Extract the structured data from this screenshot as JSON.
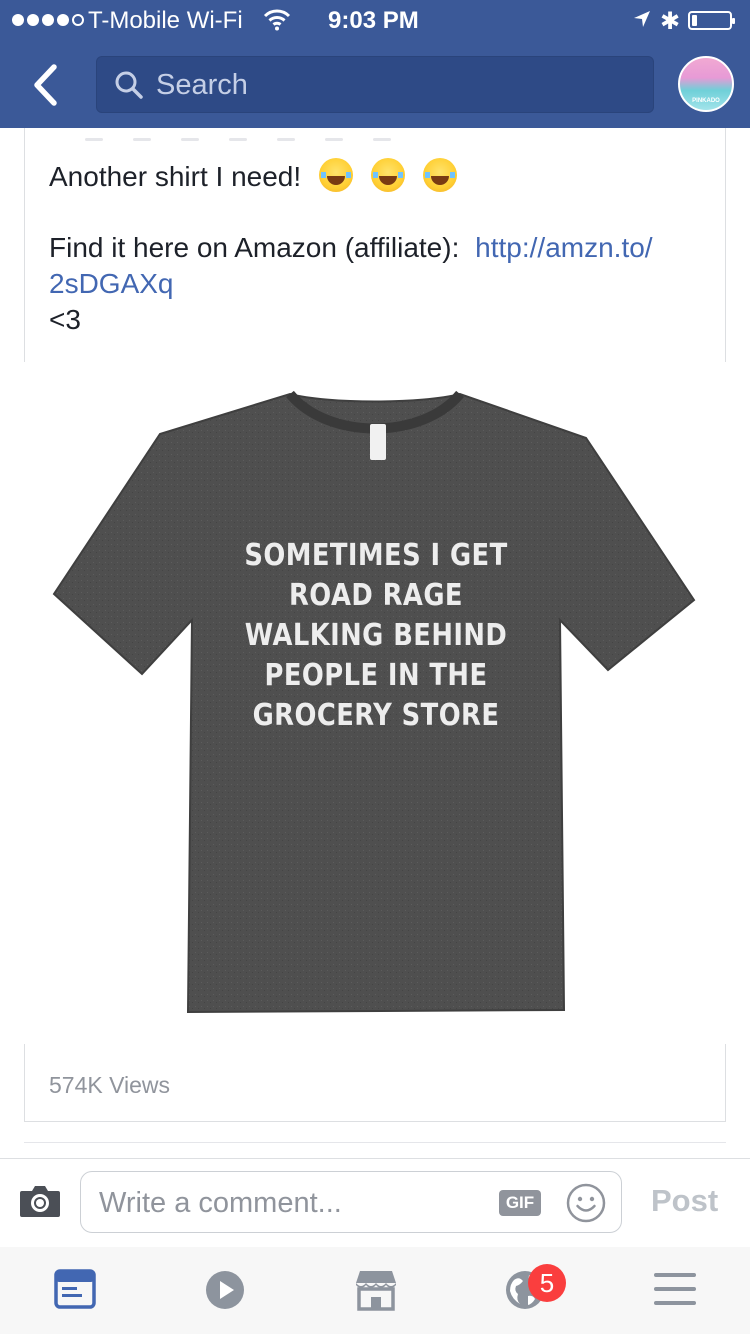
{
  "status_bar": {
    "carrier": "T-Mobile Wi-Fi",
    "time": "9:03 PM",
    "bluetooth_glyph": "✱"
  },
  "header": {
    "search_placeholder": "Search",
    "brand_color": "#3b5998",
    "avatar_caption": "PINKADO"
  },
  "post": {
    "text_line1": "Another shirt I need!",
    "text_line2_prefix": "Find it here on Amazon (affiliate):",
    "link_part1": "http://amzn.to/",
    "link_part2": "2sDGAXq",
    "text_line4": "<3",
    "link_color": "#4267b2"
  },
  "photo": {
    "shirt_lines": [
      "SOMETIMES I GET",
      "ROAD RAGE",
      "WALKING BEHIND",
      "PEOPLE IN THE",
      "GROCERY STORE"
    ],
    "shirt_color": "#505050"
  },
  "stats": {
    "views": "574K Views"
  },
  "comment_bar": {
    "placeholder": "Write a comment...",
    "gif_label": "GIF",
    "post_label": "Post"
  },
  "tab_bar": {
    "tabs": [
      "news-feed",
      "video",
      "marketplace",
      "notifications",
      "menu"
    ],
    "active_tab": "news-feed",
    "notifications_badge": "5"
  }
}
